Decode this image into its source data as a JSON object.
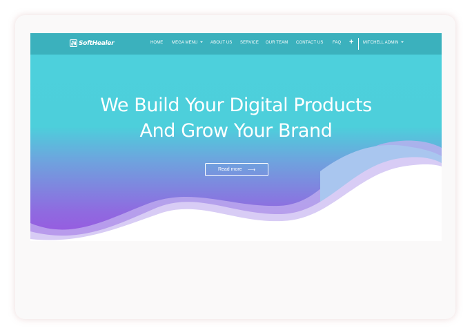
{
  "nav": {
    "brand": "SoftHealer",
    "links": [
      "HOME",
      "MEGA MENU",
      "ABOUT US",
      "SERVICE",
      "OUR TEAM",
      "CONTACT US",
      "FAQ"
    ],
    "plus": "+",
    "user": "MITCHELL ADMIN"
  },
  "hero": {
    "headline_line1": "We Build Your Digital Products",
    "headline_line2": "And Grow Your Brand",
    "cta": "Read more",
    "cta_arrow": "⟶"
  },
  "colors": {
    "navbar": "#3bb1bd",
    "hero_top": "#4dd0dc",
    "hero_bottom": "#9a55e0",
    "text": "#ffffff"
  }
}
